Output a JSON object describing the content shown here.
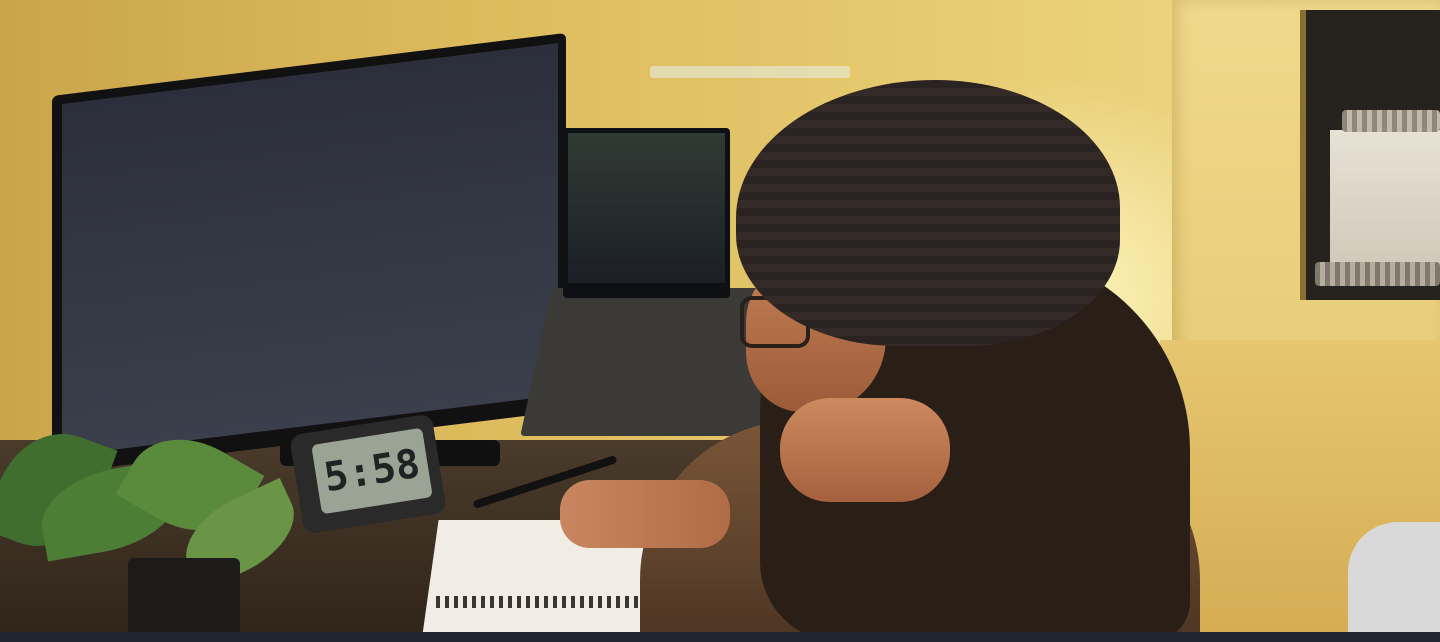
{
  "clock": {
    "time": "5:58"
  }
}
